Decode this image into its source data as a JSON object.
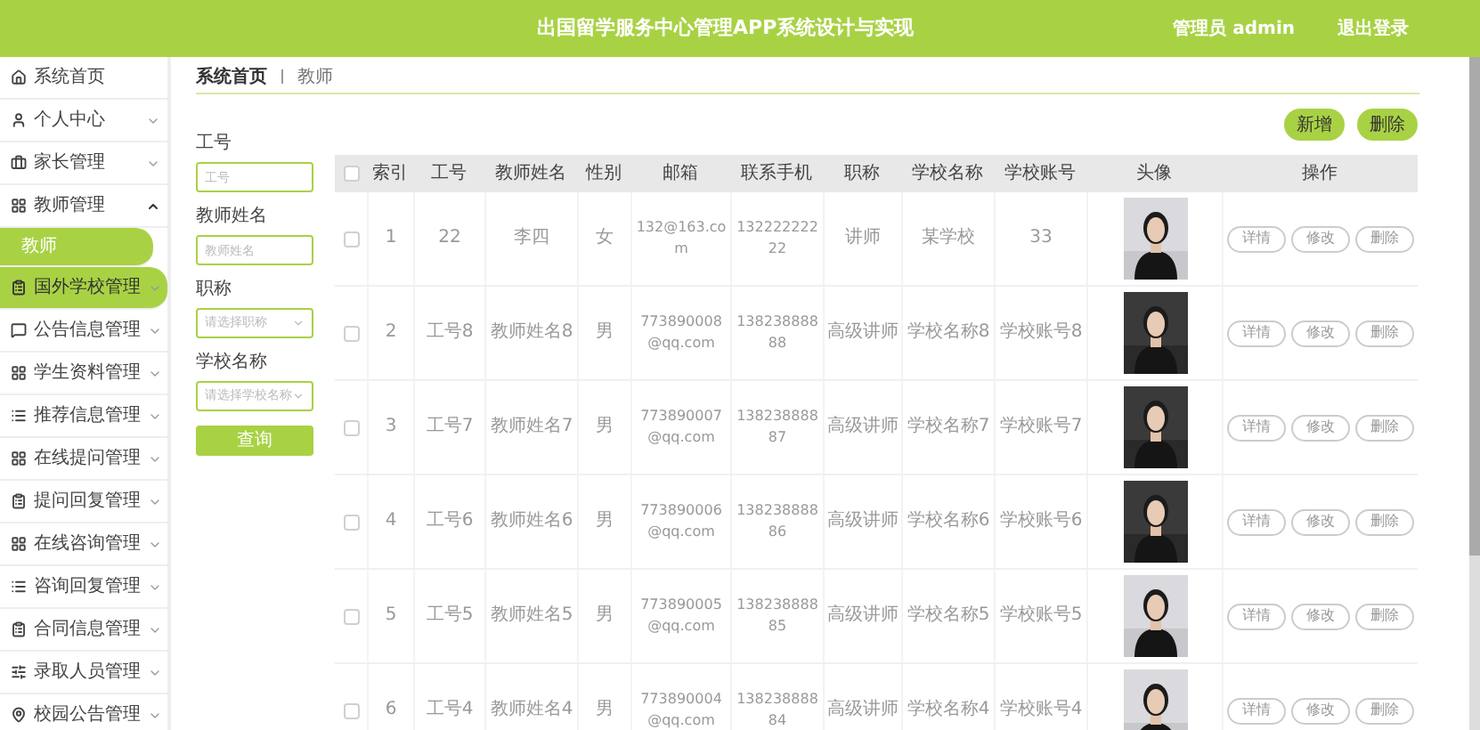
{
  "header": {
    "title": "出国留学服务中心管理APP系统设计与实现",
    "user": "管理员 admin",
    "logout": "退出登录"
  },
  "sidebar": {
    "items": [
      {
        "label": "系统首页",
        "expanded": false,
        "selected": false
      },
      {
        "label": "个人中心",
        "expanded": false,
        "selected": false
      },
      {
        "label": "家长管理",
        "expanded": false,
        "selected": false
      },
      {
        "label": "教师管理",
        "expanded": true,
        "selected": false,
        "children": [
          {
            "label": "教师",
            "selected": true
          }
        ]
      },
      {
        "label": "国外学校管理",
        "expanded": false,
        "selected": true
      },
      {
        "label": "公告信息管理",
        "expanded": false,
        "selected": false
      },
      {
        "label": "学生资料管理",
        "expanded": false,
        "selected": false
      },
      {
        "label": "推荐信息管理",
        "expanded": false,
        "selected": false
      },
      {
        "label": "在线提问管理",
        "expanded": false,
        "selected": false
      },
      {
        "label": "提问回复管理",
        "expanded": false,
        "selected": false
      },
      {
        "label": "在线咨询管理",
        "expanded": false,
        "selected": false
      },
      {
        "label": "咨询回复管理",
        "expanded": false,
        "selected": false
      },
      {
        "label": "合同信息管理",
        "expanded": false,
        "selected": false
      },
      {
        "label": "录取人员管理",
        "expanded": false,
        "selected": false
      },
      {
        "label": "校园公告管理",
        "expanded": false,
        "selected": false
      }
    ]
  },
  "breadcrumb": [
    "系统首页",
    "教师"
  ],
  "filters": [
    {
      "label": "工号",
      "kind": "input",
      "placeholder": "工号"
    },
    {
      "label": "教师姓名",
      "kind": "input",
      "placeholder": "教师姓名"
    },
    {
      "label": "职称",
      "kind": "select",
      "placeholder": "请选择职称"
    },
    {
      "label": "学校名称",
      "kind": "select",
      "placeholder": "请选择学校名称"
    }
  ],
  "search_button": "查询",
  "actions": [
    "新增",
    "删除"
  ],
  "table": {
    "header_checked": false,
    "columns": [
      "索引",
      "工号",
      "教师姓名",
      "性别",
      "邮箱",
      "联系手机",
      "职称",
      "学校名称",
      "学校账号",
      "头像",
      "操作"
    ],
    "rows": [
      {
        "checked": false,
        "cells": [
          "1",
          "22",
          "李四",
          "女",
          "132@163.com",
          "13222222222",
          "讲师",
          "某学校",
          "33"
        ],
        "actions": [
          "详情",
          "修改",
          "删除"
        ]
      },
      {
        "checked": false,
        "cells": [
          "2",
          "工号8",
          "教师姓名8",
          "男",
          "773890008@qq.com",
          "13823888888",
          "高级讲师",
          "学校名称8",
          "学校账号8"
        ],
        "actions": [
          "详情",
          "修改",
          "删除"
        ]
      },
      {
        "checked": false,
        "cells": [
          "3",
          "工号7",
          "教师姓名7",
          "男",
          "773890007@qq.com",
          "13823888887",
          "高级讲师",
          "学校名称7",
          "学校账号7"
        ],
        "actions": [
          "详情",
          "修改",
          "删除"
        ]
      },
      {
        "checked": false,
        "cells": [
          "4",
          "工号6",
          "教师姓名6",
          "男",
          "773890006@qq.com",
          "13823888886",
          "高级讲师",
          "学校名称6",
          "学校账号6"
        ],
        "actions": [
          "详情",
          "修改",
          "删除"
        ]
      },
      {
        "checked": false,
        "cells": [
          "5",
          "工号5",
          "教师姓名5",
          "男",
          "773890005@qq.com",
          "13823888885",
          "高级讲师",
          "学校名称5",
          "学校账号5"
        ],
        "actions": [
          "详情",
          "修改",
          "删除"
        ]
      },
      {
        "checked": false,
        "cells": [
          "6",
          "工号4",
          "教师姓名4",
          "男",
          "773890004@qq.com",
          "13823888884",
          "高级讲师",
          "学校名称4",
          "学校账号4"
        ],
        "actions": [
          "详情",
          "修改",
          "删除"
        ]
      }
    ]
  }
}
